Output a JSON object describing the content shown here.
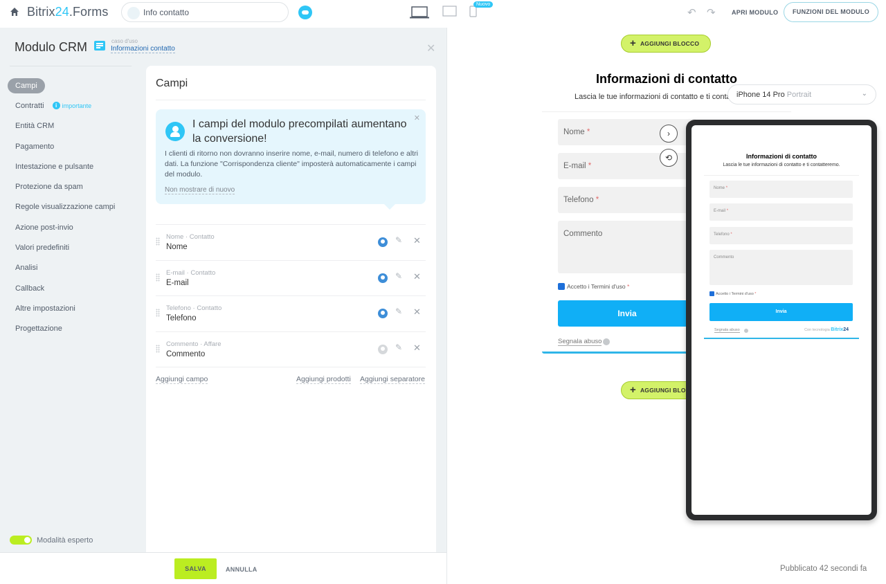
{
  "topbar": {
    "brand_prefix": "Bitrix",
    "brand_num": "24",
    "brand_suffix": ".Forms",
    "form_name": "Info contatto",
    "new_badge": "Nuovo",
    "open_form": "APRI MODULO",
    "form_functions": "FUNZIONI DEL MODULO"
  },
  "panel": {
    "title": "Modulo CRM",
    "use_case_label": "caso d'uso",
    "use_case_value": "Informazioni contatto",
    "nav": [
      {
        "label": "Campi",
        "active": true
      },
      {
        "label": "Contratti",
        "badge": "importante"
      },
      {
        "label": "Entità CRM"
      },
      {
        "label": "Pagamento"
      },
      {
        "label": "Intestazione e pulsante"
      },
      {
        "label": "Protezione da spam"
      },
      {
        "label": "Regole visualizzazione campi"
      },
      {
        "label": "Azione post-invio"
      },
      {
        "label": "Valori predefiniti"
      },
      {
        "label": "Analisi"
      },
      {
        "label": "Callback"
      },
      {
        "label": "Altre impostazioni"
      },
      {
        "label": "Progettazione"
      }
    ],
    "expert_mode": "Modalità esperto",
    "expert_mode_on": true
  },
  "fields_card": {
    "title": "Campi",
    "tip": {
      "heading": "I campi del modulo precompilati aumentano la conversione!",
      "body": "I clienti di ritorno non dovranno inserire nome, e-mail, numero di telefono e altri dati. La funzione \"Corrispondenza cliente\" imposterà automaticamente i campi del modulo.",
      "dismiss": "Non mostrare di nuovo"
    },
    "rows": [
      {
        "sub": "Nome · Contatto",
        "name": "Nome",
        "autofill": true
      },
      {
        "sub": "E-mail · Contatto",
        "name": "E-mail",
        "autofill": true
      },
      {
        "sub": "Telefono · Contatto",
        "name": "Telefono",
        "autofill": true
      },
      {
        "sub": "Commento · Affare",
        "name": "Commento",
        "autofill": false
      }
    ],
    "add_field": "Aggiungi campo",
    "add_products": "Aggiungi prodotti",
    "add_separator": "Aggiungi separatore"
  },
  "footer": {
    "save": "SALVA",
    "cancel": "ANNULLA"
  },
  "preview": {
    "add_block": "AGGIUNGI BLOCCO",
    "form_title": "Informazioni di contatto",
    "form_subtitle": "Lascia le tue informazioni di contatto e ti contatteremo.",
    "fields": [
      "Nome",
      "E-mail",
      "Telefono",
      "Commento"
    ],
    "required_mark": "*",
    "terms": "Accetto i Termini d'uso",
    "submit": "Invia",
    "report_abuse": "Segnala abuso",
    "powered_by": "Con tecnologia",
    "powered_brand": "Bitrix",
    "powered_num": "24",
    "device": "iPhone 14 Pro",
    "orientation": "Portrait",
    "published": "Pubblicato 42 secondi fa"
  },
  "colors": {
    "accent": "#2fc6f6",
    "lime": "#bbed21",
    "submit_blue": "#10aff6"
  }
}
